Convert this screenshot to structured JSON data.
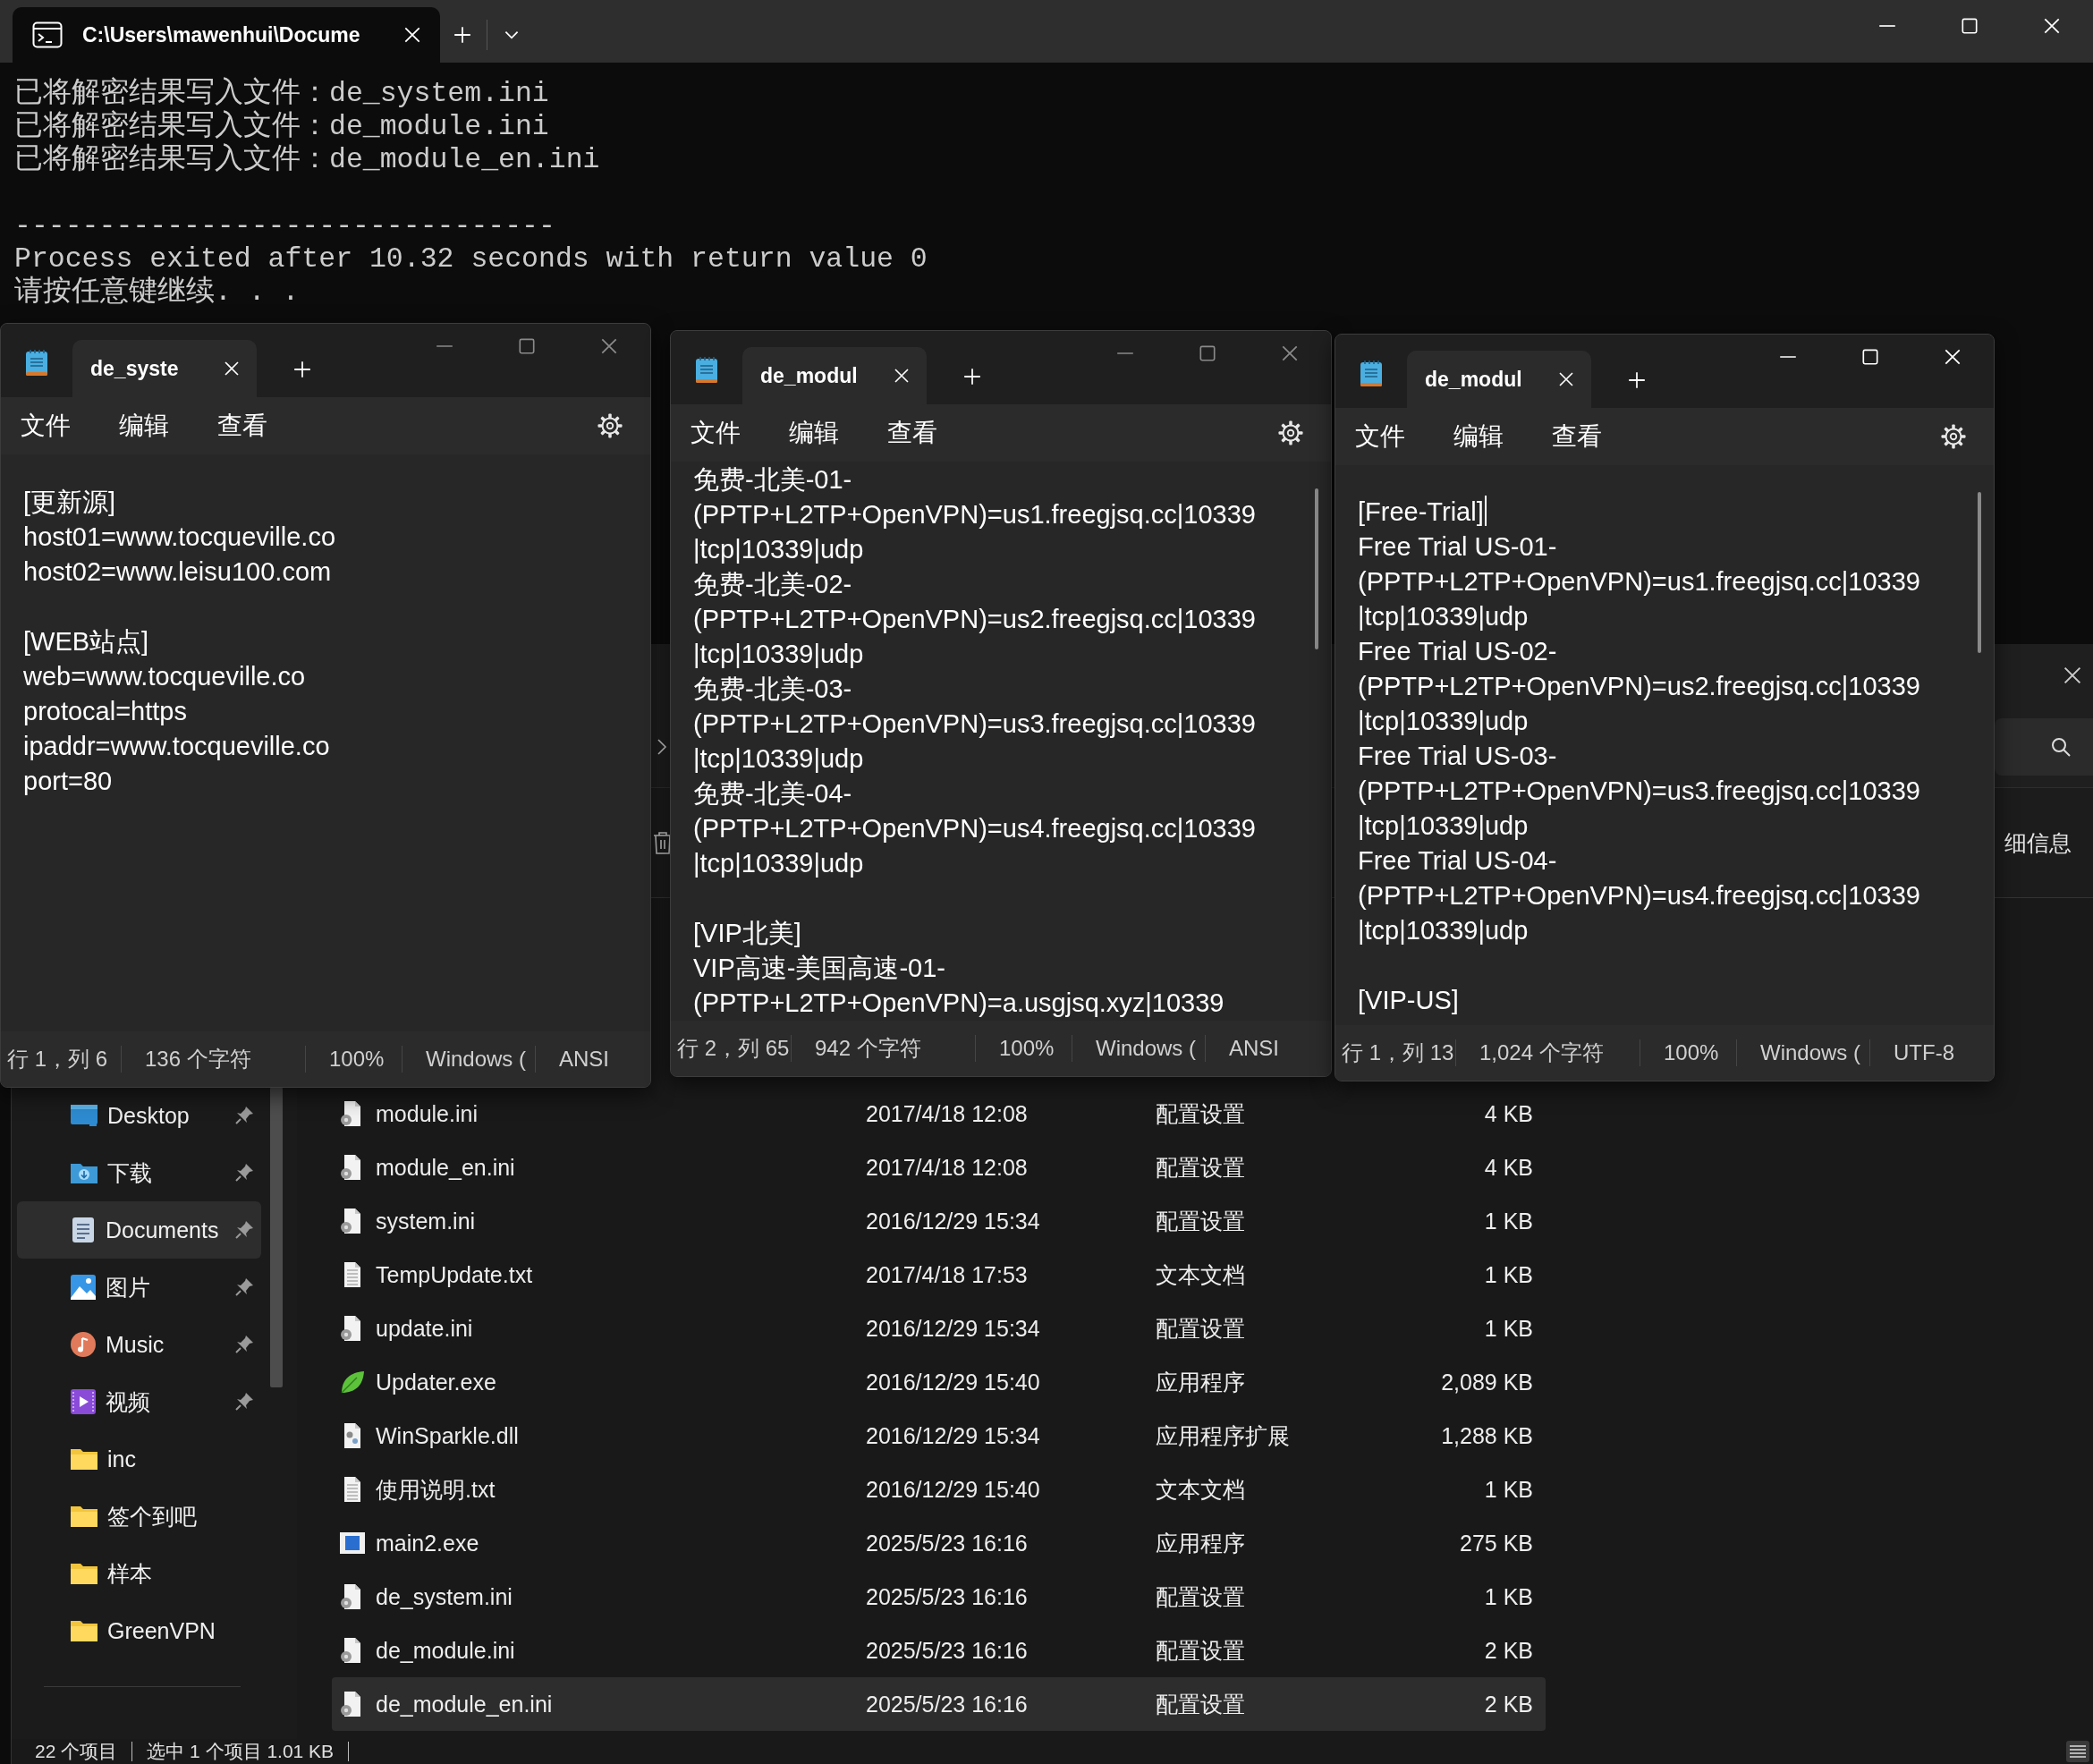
{
  "terminal": {
    "tab_title": "C:\\Users\\mawenhui\\Docume",
    "blocks": [
      [
        "已将解密结果写入文件：de_system.ini",
        "已将解密结果写入文件：de_module.ini",
        "已将解密结果写入文件：de_module_en.ini"
      ],
      [
        "--------------------------------",
        "Process exited after 10.32 seconds with return value 0",
        "请按任意键继续. . ."
      ]
    ]
  },
  "notepads": [
    {
      "tab_title": "de_syste",
      "active": false,
      "caret_shown": false,
      "scrollbar_shown": false,
      "menu": [
        "文件",
        "编辑",
        "查看"
      ],
      "blocks": [
        [
          "[更新源]",
          "host01=www.tocqueville.co",
          "host02=www.leisu100.com"
        ],
        [
          "[WEB站点]",
          "web=www.tocqueville.co",
          "protocal=https",
          "ipaddr=www.tocqueville.co",
          "port=80"
        ]
      ],
      "status": [
        "行 1，列 6",
        "136 个字符",
        "100%",
        "Windows (",
        "ANSI"
      ]
    },
    {
      "tab_title": "de_modul",
      "active": false,
      "caret_shown": false,
      "scrollbar_shown": true,
      "menu": [
        "文件",
        "编辑",
        "查看"
      ],
      "blocks": [
        [
          "免费-北美-01-",
          "(PPTP+L2TP+OpenVPN)=us1.freegjsq.cc|10339",
          "|tcp|10339|udp",
          "免费-北美-02-",
          "(PPTP+L2TP+OpenVPN)=us2.freegjsq.cc|10339",
          "|tcp|10339|udp",
          "免费-北美-03-",
          "(PPTP+L2TP+OpenVPN)=us3.freegjsq.cc|10339",
          "|tcp|10339|udp",
          "免费-北美-04-",
          "(PPTP+L2TP+OpenVPN)=us4.freegjsq.cc|10339",
          "|tcp|10339|udp"
        ],
        [
          "[VIP北美]",
          "VIP高速-美国高速-01-",
          "(PPTP+L2TP+OpenVPN)=a.usgjsq.xyz|10339"
        ]
      ],
      "status": [
        "行 2，列 65",
        "942 个字符",
        "100%",
        "Windows (",
        "ANSI"
      ]
    },
    {
      "tab_title": "de_modul",
      "active": true,
      "caret_shown": true,
      "scrollbar_shown": true,
      "menu": [
        "文件",
        "编辑",
        "查看"
      ],
      "blocks": [
        [
          "[Free-Trial]",
          "Free Trial US-01-",
          "(PPTP+L2TP+OpenVPN)=us1.freegjsq.cc|10339",
          "|tcp|10339|udp",
          "Free Trial US-02-",
          "(PPTP+L2TP+OpenVPN)=us2.freegjsq.cc|10339",
          "|tcp|10339|udp",
          "Free Trial US-03-",
          "(PPTP+L2TP+OpenVPN)=us3.freegjsq.cc|10339",
          "|tcp|10339|udp",
          "Free Trial US-04-",
          "(PPTP+L2TP+OpenVPN)=us4.freegjsq.cc|10339",
          "|tcp|10339|udp"
        ],
        [
          "[VIP-US]"
        ]
      ],
      "status": [
        "行 1，列 13",
        "1,024 个字符",
        "100%",
        "Windows (",
        "UTF-8"
      ]
    }
  ],
  "explorer": {
    "details_label": "细信息",
    "nav": [
      {
        "label": "Desktop",
        "kind": "desktop",
        "pinned": true,
        "selected": false
      },
      {
        "label": "下载",
        "kind": "downloads",
        "pinned": true,
        "selected": false
      },
      {
        "label": "Documents",
        "kind": "documents",
        "pinned": true,
        "selected": true
      },
      {
        "label": "图片",
        "kind": "pictures",
        "pinned": true,
        "selected": false
      },
      {
        "label": "Music",
        "kind": "music",
        "pinned": true,
        "selected": false
      },
      {
        "label": "视频",
        "kind": "videos",
        "pinned": true,
        "selected": false
      },
      {
        "label": "inc",
        "kind": "folder",
        "pinned": false,
        "selected": false
      },
      {
        "label": "签个到吧",
        "kind": "folder",
        "pinned": false,
        "selected": false
      },
      {
        "label": "样本",
        "kind": "folder",
        "pinned": false,
        "selected": false
      },
      {
        "label": "GreenVPN",
        "kind": "folder",
        "pinned": false,
        "selected": false
      }
    ],
    "files": [
      {
        "name": "module.ini",
        "date": "2017/4/18 12:08",
        "type": "配置设置",
        "size": "4 KB",
        "kind": "config",
        "selected": false
      },
      {
        "name": "module_en.ini",
        "date": "2017/4/18 12:08",
        "type": "配置设置",
        "size": "4 KB",
        "kind": "config",
        "selected": false
      },
      {
        "name": "system.ini",
        "date": "2016/12/29 15:34",
        "type": "配置设置",
        "size": "1 KB",
        "kind": "config",
        "selected": false
      },
      {
        "name": "TempUpdate.txt",
        "date": "2017/4/18 17:53",
        "type": "文本文档",
        "size": "1 KB",
        "kind": "text",
        "selected": false
      },
      {
        "name": "update.ini",
        "date": "2016/12/29 15:34",
        "type": "配置设置",
        "size": "1 KB",
        "kind": "config",
        "selected": false
      },
      {
        "name": "Updater.exe",
        "date": "2016/12/29 15:40",
        "type": "应用程序",
        "size": "2,089 KB",
        "kind": "leaf",
        "selected": false
      },
      {
        "name": "WinSparkle.dll",
        "date": "2016/12/29 15:34",
        "type": "应用程序扩展",
        "size": "1,288 KB",
        "kind": "library",
        "selected": false
      },
      {
        "name": "使用说明.txt",
        "date": "2016/12/29 15:40",
        "type": "文本文档",
        "size": "1 KB",
        "kind": "text",
        "selected": false
      },
      {
        "name": "main2.exe",
        "date": "2025/5/23 16:16",
        "type": "应用程序",
        "size": "275 KB",
        "kind": "window",
        "selected": false
      },
      {
        "name": "de_system.ini",
        "date": "2025/5/23 16:16",
        "type": "配置设置",
        "size": "1 KB",
        "kind": "config",
        "selected": false
      },
      {
        "name": "de_module.ini",
        "date": "2025/5/23 16:16",
        "type": "配置设置",
        "size": "2 KB",
        "kind": "config",
        "selected": false
      },
      {
        "name": "de_module_en.ini",
        "date": "2025/5/23 16:16",
        "type": "配置设置",
        "size": "2 KB",
        "kind": "config",
        "selected": true
      }
    ],
    "status": [
      "22 个项目",
      "选中 1 个项目 1.01 KB"
    ]
  }
}
